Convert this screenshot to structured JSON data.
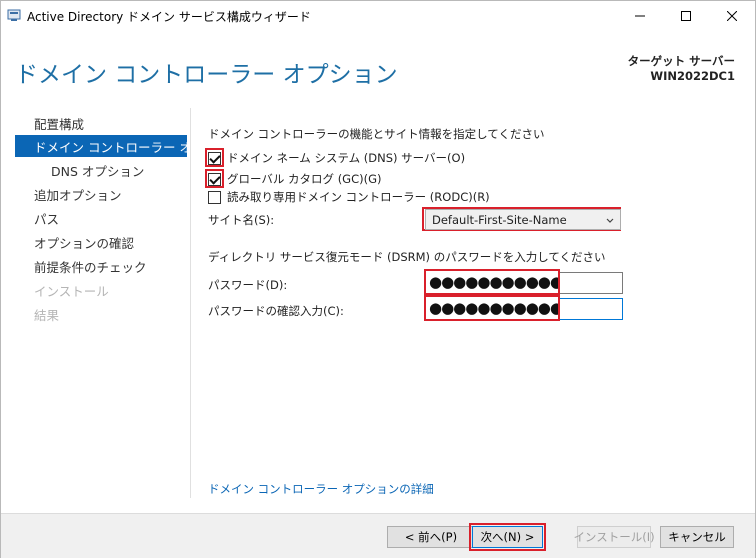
{
  "window": {
    "title": "Active Directory ドメイン サービス構成ウィザード",
    "controls": {
      "minimize": "minimize-icon",
      "maximize": "maximize-icon",
      "close": "close-icon"
    }
  },
  "header": {
    "page_title": "ドメイン コントローラー オプション",
    "target_label": "ターゲット サーバー",
    "target_value": "WIN2022DC1"
  },
  "sidebar": {
    "items": [
      {
        "label": "配置構成",
        "state": "normal"
      },
      {
        "label": "ドメイン コントローラー オプシ...",
        "state": "active"
      },
      {
        "label": "DNS オプション",
        "state": "normal"
      },
      {
        "label": "追加オプション",
        "state": "normal"
      },
      {
        "label": "パス",
        "state": "normal"
      },
      {
        "label": "オプションの確認",
        "state": "normal"
      },
      {
        "label": "前提条件のチェック",
        "state": "normal"
      },
      {
        "label": "インストール",
        "state": "disabled"
      },
      {
        "label": "結果",
        "state": "disabled"
      }
    ]
  },
  "main": {
    "capabilities_heading": "ドメイン コントローラーの機能とサイト情報を指定してください",
    "checkboxes": [
      {
        "label": "ドメイン ネーム システム (DNS) サーバー(O)",
        "checked": true
      },
      {
        "label": "グローバル カタログ (GC)(G)",
        "checked": true
      },
      {
        "label": "読み取り専用ドメイン コントローラー (RODC)(R)",
        "checked": false
      }
    ],
    "site_label": "サイト名(S):",
    "site_value": "Default-First-Site-Name",
    "dsrm_heading": "ディレクトリ サービス復元モード (DSRM) のパスワードを入力してください",
    "password_label": "パスワード(D):",
    "password_mask": "●●●●●●●●●●●",
    "confirm_label": "パスワードの確認入力(C):",
    "confirm_mask": "●●●●●●●●●●●",
    "details_link": "ドメイン コントローラー オプションの詳細"
  },
  "footer": {
    "back": "< 前へ(P)",
    "next": "次へ(N) >",
    "install": "インストール(I)",
    "cancel": "キャンセル"
  },
  "colors": {
    "accent": "#0b66b5",
    "title": "#1e6fa5",
    "highlight": "#d9202b"
  }
}
